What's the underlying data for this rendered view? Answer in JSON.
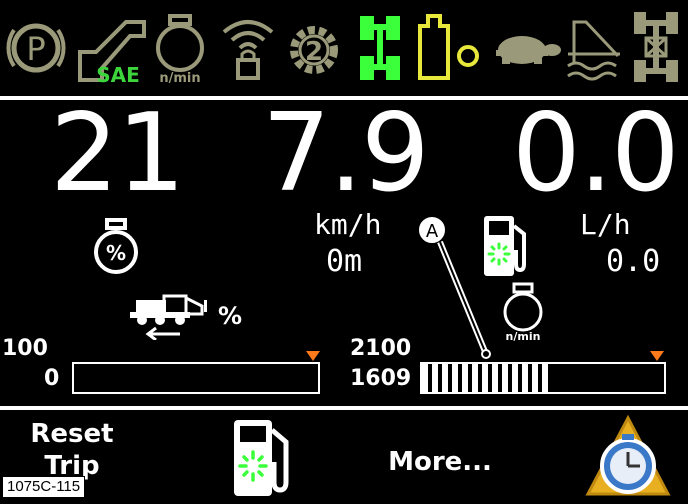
{
  "top_icons": [
    {
      "name": "parking-brake-icon",
      "color": "#9a9a7a"
    },
    {
      "name": "hitch-sae-icon",
      "label": "SAE",
      "label_color": "#3cd63c",
      "color": "#9a9a7a"
    },
    {
      "name": "engine-rpm-icon",
      "label": "n/min",
      "color": "#9a9a7a"
    },
    {
      "name": "wireless-lock-icon",
      "color": "#9a9a7a"
    },
    {
      "name": "gear-2-icon",
      "label": "2",
      "color": "#9a9a7a"
    },
    {
      "name": "four-wheel-drive-icon",
      "color": "#3cff3c"
    },
    {
      "name": "fuel-tank-icon",
      "color": "#e8e83c"
    },
    {
      "name": "turtle-slow-icon",
      "color": "#9a9a7a"
    },
    {
      "name": "hydraulic-icon",
      "color": "#9a9a7a"
    },
    {
      "name": "differential-lock-icon",
      "color": "#9a9a7a"
    }
  ],
  "readouts": {
    "engine_load": "21",
    "speed": "7.9",
    "fuel_rate": "0.0"
  },
  "units": {
    "speed_unit": "km/h",
    "fuel_unit": "L/h",
    "distance": "0m",
    "fuel_total": "0.0",
    "percent": "%"
  },
  "callout": "A",
  "bars": {
    "left": {
      "max_label": "100",
      "min_label": "0",
      "fill_fraction": 0.0
    },
    "right": {
      "max_label": "2100",
      "current_label": "1609",
      "fill_fraction": 0.53
    }
  },
  "rpm_icon_label": "n/min",
  "buttons": {
    "reset_trip_line1": "Reset",
    "reset_trip_line2": "Trip",
    "more": "More..."
  },
  "figure_tag": "1075C-115",
  "colors": {
    "accent_green": "#3cff3c",
    "warning_yellow": "#e8e83c",
    "marker_orange": "#ff7a1a",
    "inactive_gray": "#9a9a7a"
  }
}
